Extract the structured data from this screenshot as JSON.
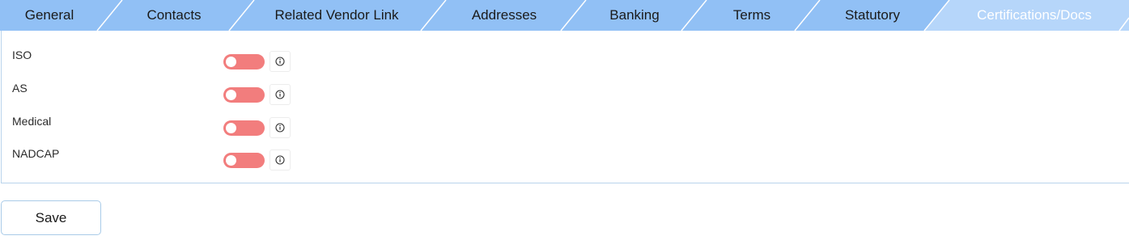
{
  "tabs": [
    {
      "label": "General",
      "active": false
    },
    {
      "label": "Contacts",
      "active": false
    },
    {
      "label": "Related Vendor Link",
      "active": false
    },
    {
      "label": "Addresses",
      "active": false
    },
    {
      "label": "Banking",
      "active": false
    },
    {
      "label": "Terms",
      "active": false
    },
    {
      "label": "Statutory",
      "active": false
    },
    {
      "label": "Certifications/Docs",
      "active": true
    }
  ],
  "certifications": [
    {
      "label": "ISO",
      "enabled": false,
      "icon": "info-icon"
    },
    {
      "label": "AS",
      "enabled": false,
      "icon": "info-icon"
    },
    {
      "label": "Medical",
      "enabled": false,
      "icon": "info-icon"
    },
    {
      "label": "NADCAP",
      "enabled": false,
      "icon": "info-icon"
    }
  ],
  "actions": {
    "save_label": "Save"
  },
  "colors": {
    "tab_inactive": "#91c0f5",
    "tab_active": "#b6d6fa",
    "tab_separator": "#ffffff",
    "toggle_off": "#f27d7d",
    "panel_border": "#b9d4ec"
  }
}
